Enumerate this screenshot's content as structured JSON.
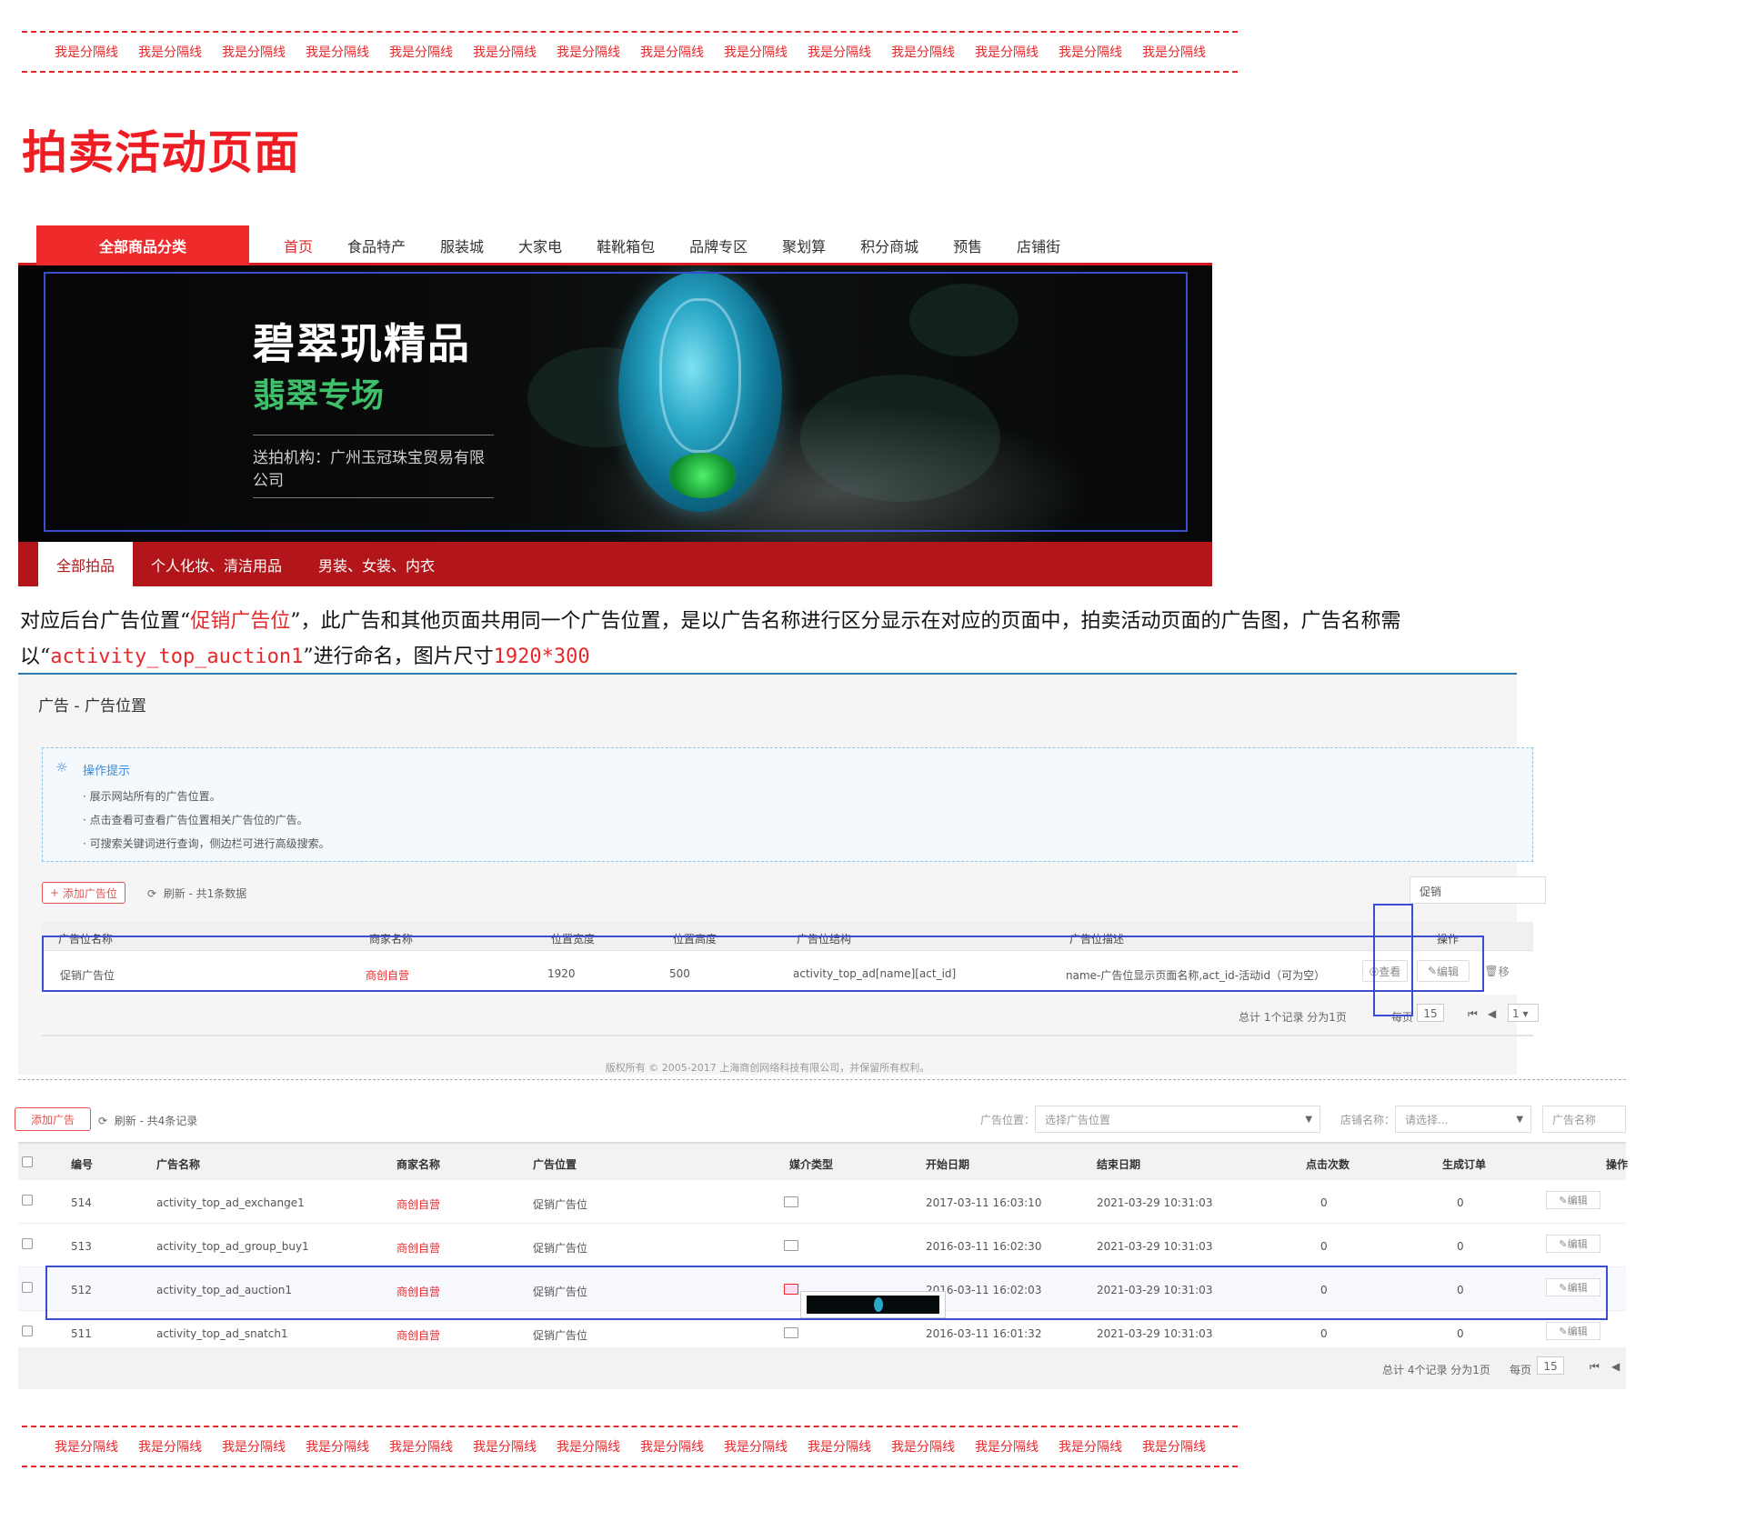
{
  "divider_label": "我是分隔线",
  "divider_count": 14,
  "page_title": "拍卖活动页面",
  "store": {
    "category_button": "全部商品分类",
    "nav_items": [
      "首页",
      "食品特产",
      "服装城",
      "大家电",
      "鞋靴箱包",
      "品牌专区",
      "聚划算",
      "积分商城",
      "预售",
      "店铺街"
    ],
    "active_nav": 0,
    "banner": {
      "line1": "碧翠玑精品",
      "line2": "翡翠专场",
      "line3": "送拍机构：广州玉冠珠宝贸易有限公司"
    },
    "tabs": [
      "全部拍品",
      "个人化妆、清洁用品",
      "男装、女装、内衣"
    ]
  },
  "note": {
    "p1": "对应后台广告位置“",
    "p2": "促销广告位",
    "p3": "”，此广告和其他页面共用同一个广告位置，是以广告名称进行区分显示在对应的页面中，拍卖活动页面的广告图，广告名称需以“",
    "p4": "activity_top_auction1",
    "p5": "”进行命名，图片尺寸",
    "p6": "1920*300"
  },
  "panel1": {
    "title": "广告 - 广告位置",
    "tips_title": "操作提示",
    "tips": [
      "展示网站所有的广告位置。",
      "点击查看可查看广告位置相关广告位的广告。",
      "可搜索关键词进行查询，侧边栏可进行高级搜索。"
    ],
    "add_button": "添加广告位",
    "refresh": "刷新 - 共1条数据",
    "search_value": "促销",
    "columns": [
      "广告位名称",
      "商家名称",
      "位置宽度",
      "位置高度",
      "广告位结构",
      "广告位描述",
      "操作"
    ],
    "row": {
      "name": "促销广告位",
      "merchant": "商创自营",
      "width": "1920",
      "height": "500",
      "structure": "activity_top_ad[name][act_id]",
      "description": "name-广告位显示页面名称,act_id-活动id（可为空）"
    },
    "buttons": [
      "查看",
      "编辑",
      "移"
    ],
    "pager_text": "总计 1个记录 分为1页",
    "per_page_label": "每页",
    "per_page": "15",
    "page": "1",
    "footer": "版权所有 © 2005-2017 上海商创网络科技有限公司，并保留所有权利。"
  },
  "panel2": {
    "add_button": "添加广告",
    "refresh": "刷新 - 共4条记录",
    "filter_position_label": "广告位置：",
    "filter_position_placeholder": "选择广告位置",
    "filter_store_label": "店铺名称：",
    "filter_store_placeholder": "请选择...",
    "filter_name_placeholder": "广告名称",
    "columns": [
      "编号",
      "广告名称",
      "商家名称",
      "广告位置",
      "媒介类型",
      "开始日期",
      "结束日期",
      "点击次数",
      "生成订单",
      "操作"
    ],
    "rows": [
      {
        "id": "514",
        "name": "activity_top_ad_exchange1",
        "merchant": "商创自营",
        "position": "促销广告位",
        "start": "2017-03-11 16:03:10",
        "end": "2021-03-29 10:31:03",
        "clicks": "0",
        "orders": "0"
      },
      {
        "id": "513",
        "name": "activity_top_ad_group_buy1",
        "merchant": "商创自营",
        "position": "促销广告位",
        "start": "2016-03-11 16:02:30",
        "end": "2021-03-29 10:31:03",
        "clicks": "0",
        "orders": "0"
      },
      {
        "id": "512",
        "name": "activity_top_ad_auction1",
        "merchant": "商创自营",
        "position": "促销广告位",
        "start": "2016-03-11 16:02:03",
        "end": "2021-03-29 10:31:03",
        "clicks": "0",
        "orders": "0"
      },
      {
        "id": "511",
        "name": "activity_top_ad_snatch1",
        "merchant": "商创自营",
        "position": "促销广告位",
        "start": "2016-03-11 16:01:32",
        "end": "2021-03-29 10:31:03",
        "clicks": "0",
        "orders": "0"
      }
    ],
    "edit_button": "编辑",
    "pager_text": "总计 4个记录 分为1页",
    "per_page_label": "每页",
    "per_page": "15"
  },
  "colors": {
    "accent_red": "#e8272b",
    "highlight_blue": "#3a4fd0",
    "nav_red": "#b3161a"
  }
}
